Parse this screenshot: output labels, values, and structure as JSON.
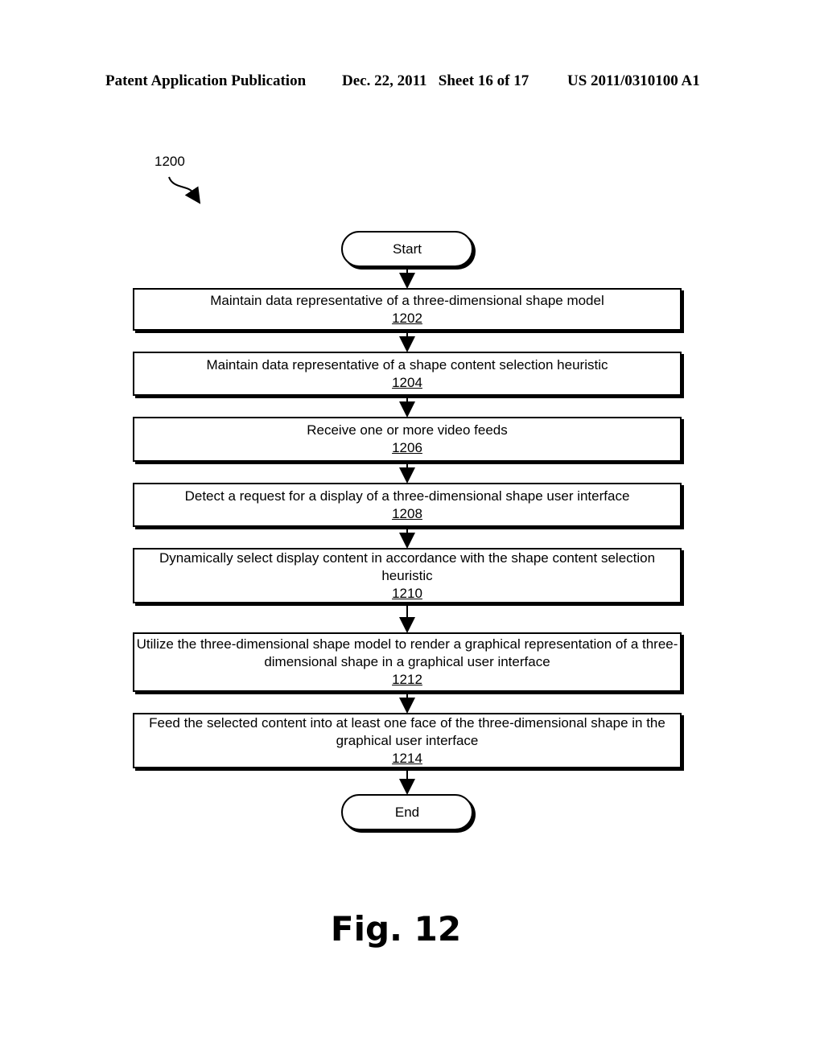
{
  "header": {
    "publication": "Patent Application Publication",
    "date_sheet": "Dec. 22, 2011   Sheet 16 of 17",
    "patent_number": "US 2011/0310100 A1"
  },
  "figure_ref": "1200",
  "flowchart": {
    "start": "Start",
    "end": "End",
    "steps": [
      {
        "text": "Maintain data representative of a three-dimensional shape model",
        "num": "1202"
      },
      {
        "text": "Maintain data representative of a shape content selection heuristic",
        "num": "1204"
      },
      {
        "text": "Receive one or more video feeds",
        "num": "1206"
      },
      {
        "text": "Detect a request for a display of a three-dimensional shape user interface",
        "num": "1208"
      },
      {
        "text": "Dynamically select display content in accordance with the shape content selection heuristic",
        "num": "1210"
      },
      {
        "text": "Utilize the three-dimensional shape model to render a graphical representation of a three-dimensional shape in a graphical user interface",
        "num": "1212"
      },
      {
        "text": "Feed the selected content into at least one face of the three-dimensional shape in the graphical user interface",
        "num": "1214"
      }
    ]
  },
  "figure_label": "Fig. 12"
}
